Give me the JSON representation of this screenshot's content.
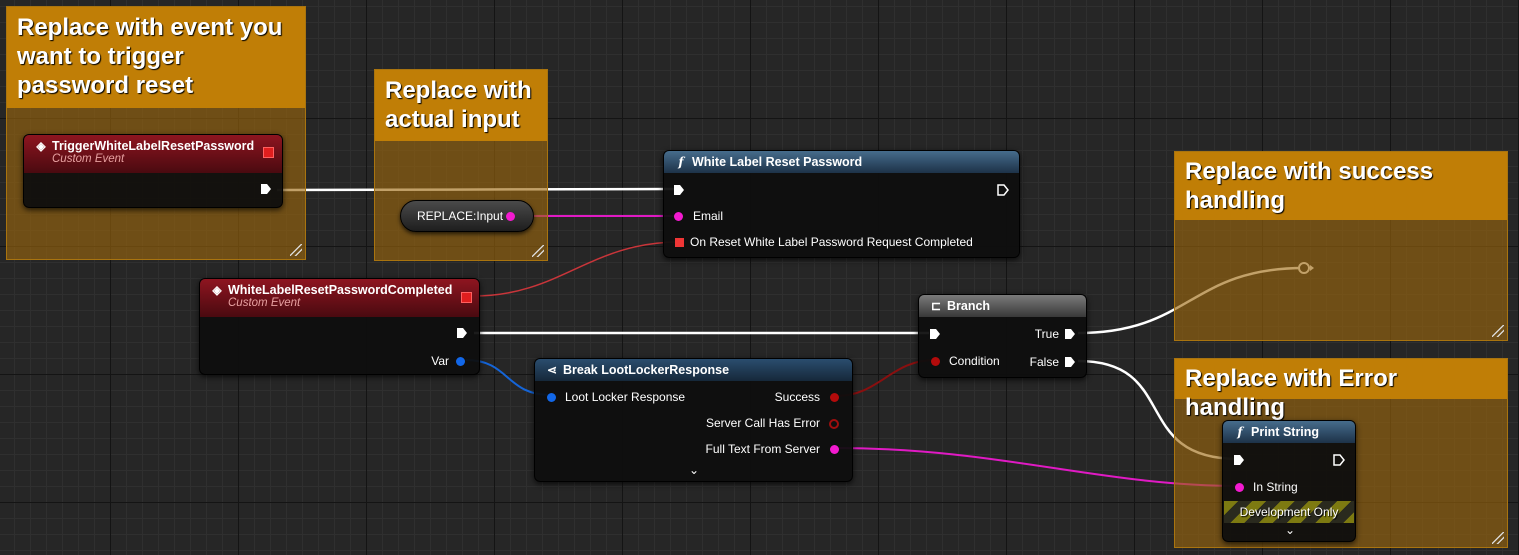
{
  "comments": [
    {
      "id": "c1",
      "title": "Replace with event you want to trigger password reset"
    },
    {
      "id": "c2",
      "title": "Replace with actual input"
    },
    {
      "id": "c3",
      "title": "Replace with success handling"
    },
    {
      "id": "c4",
      "title": "Replace with Error handling"
    }
  ],
  "nodes": {
    "trigger_event": {
      "title": "TriggerWhiteLabelResetPassword",
      "subtitle": "Custom Event"
    },
    "completed_event": {
      "title": "WhiteLabelResetPasswordCompleted",
      "subtitle": "Custom Event",
      "pin_var": "Var"
    },
    "reset_function": {
      "title": "White Label Reset Password",
      "pin_email": "Email",
      "pin_delegate": "On Reset White Label Password Request Completed"
    },
    "input_variable": {
      "label": "REPLACE:Input"
    },
    "branch": {
      "title": "Branch",
      "pin_true": "True",
      "pin_false": "False",
      "pin_condition": "Condition"
    },
    "break_response": {
      "title": "Break LootLockerResponse",
      "pin_input": "Loot Locker Response",
      "pin_success": "Success",
      "pin_error": "Server Call Has Error",
      "pin_fulltext": "Full Text From Server"
    },
    "print_string": {
      "title": "Print String",
      "pin_instring": "In String",
      "dev_only": "Development Only"
    }
  },
  "icons": {
    "event": "diamond-arrow-icon",
    "function": "function-f-icon",
    "branch": "branch-icon",
    "break": "break-struct-icon",
    "expand": "chevron-down-icon"
  },
  "colors": {
    "exec": "#ffffff",
    "string_pin": "#f31ad0",
    "struct_pin": "#1267e8",
    "bool_pin": "#b30b0b",
    "delegate_pin": "#f03636",
    "comment": "#c07e06"
  }
}
